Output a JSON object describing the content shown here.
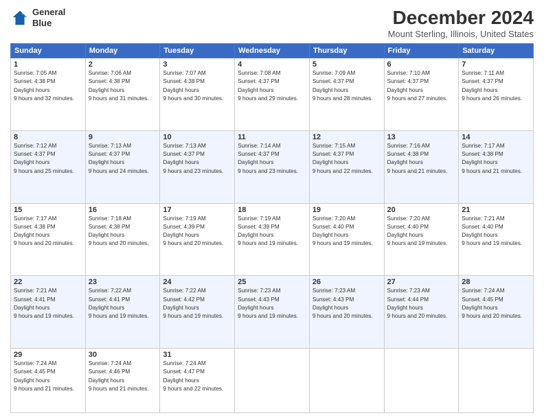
{
  "logo": {
    "line1": "General",
    "line2": "Blue"
  },
  "title": "December 2024",
  "location": "Mount Sterling, Illinois, United States",
  "days_of_week": [
    "Sunday",
    "Monday",
    "Tuesday",
    "Wednesday",
    "Thursday",
    "Friday",
    "Saturday"
  ],
  "weeks": [
    [
      {
        "day": "1",
        "sunrise": "7:05 AM",
        "sunset": "4:38 PM",
        "daylight": "9 hours and 32 minutes."
      },
      {
        "day": "2",
        "sunrise": "7:06 AM",
        "sunset": "4:38 PM",
        "daylight": "9 hours and 31 minutes."
      },
      {
        "day": "3",
        "sunrise": "7:07 AM",
        "sunset": "4:38 PM",
        "daylight": "9 hours and 30 minutes."
      },
      {
        "day": "4",
        "sunrise": "7:08 AM",
        "sunset": "4:37 PM",
        "daylight": "9 hours and 29 minutes."
      },
      {
        "day": "5",
        "sunrise": "7:09 AM",
        "sunset": "4:37 PM",
        "daylight": "9 hours and 28 minutes."
      },
      {
        "day": "6",
        "sunrise": "7:10 AM",
        "sunset": "4:37 PM",
        "daylight": "9 hours and 27 minutes."
      },
      {
        "day": "7",
        "sunrise": "7:11 AM",
        "sunset": "4:37 PM",
        "daylight": "9 hours and 26 minutes."
      }
    ],
    [
      {
        "day": "8",
        "sunrise": "7:12 AM",
        "sunset": "4:37 PM",
        "daylight": "9 hours and 25 minutes."
      },
      {
        "day": "9",
        "sunrise": "7:13 AM",
        "sunset": "4:37 PM",
        "daylight": "9 hours and 24 minutes."
      },
      {
        "day": "10",
        "sunrise": "7:13 AM",
        "sunset": "4:37 PM",
        "daylight": "9 hours and 23 minutes."
      },
      {
        "day": "11",
        "sunrise": "7:14 AM",
        "sunset": "4:37 PM",
        "daylight": "9 hours and 23 minutes."
      },
      {
        "day": "12",
        "sunrise": "7:15 AM",
        "sunset": "4:37 PM",
        "daylight": "9 hours and 22 minutes."
      },
      {
        "day": "13",
        "sunrise": "7:16 AM",
        "sunset": "4:38 PM",
        "daylight": "9 hours and 21 minutes."
      },
      {
        "day": "14",
        "sunrise": "7:17 AM",
        "sunset": "4:38 PM",
        "daylight": "9 hours and 21 minutes."
      }
    ],
    [
      {
        "day": "15",
        "sunrise": "7:17 AM",
        "sunset": "4:38 PM",
        "daylight": "9 hours and 20 minutes."
      },
      {
        "day": "16",
        "sunrise": "7:18 AM",
        "sunset": "4:38 PM",
        "daylight": "9 hours and 20 minutes."
      },
      {
        "day": "17",
        "sunrise": "7:19 AM",
        "sunset": "4:39 PM",
        "daylight": "9 hours and 20 minutes."
      },
      {
        "day": "18",
        "sunrise": "7:19 AM",
        "sunset": "4:39 PM",
        "daylight": "9 hours and 19 minutes."
      },
      {
        "day": "19",
        "sunrise": "7:20 AM",
        "sunset": "4:40 PM",
        "daylight": "9 hours and 19 minutes."
      },
      {
        "day": "20",
        "sunrise": "7:20 AM",
        "sunset": "4:40 PM",
        "daylight": "9 hours and 19 minutes."
      },
      {
        "day": "21",
        "sunrise": "7:21 AM",
        "sunset": "4:40 PM",
        "daylight": "9 hours and 19 minutes."
      }
    ],
    [
      {
        "day": "22",
        "sunrise": "7:21 AM",
        "sunset": "4:41 PM",
        "daylight": "9 hours and 19 minutes."
      },
      {
        "day": "23",
        "sunrise": "7:22 AM",
        "sunset": "4:41 PM",
        "daylight": "9 hours and 19 minutes."
      },
      {
        "day": "24",
        "sunrise": "7:22 AM",
        "sunset": "4:42 PM",
        "daylight": "9 hours and 19 minutes."
      },
      {
        "day": "25",
        "sunrise": "7:23 AM",
        "sunset": "4:43 PM",
        "daylight": "9 hours and 19 minutes."
      },
      {
        "day": "26",
        "sunrise": "7:23 AM",
        "sunset": "4:43 PM",
        "daylight": "9 hours and 20 minutes."
      },
      {
        "day": "27",
        "sunrise": "7:23 AM",
        "sunset": "4:44 PM",
        "daylight": "9 hours and 20 minutes."
      },
      {
        "day": "28",
        "sunrise": "7:24 AM",
        "sunset": "4:45 PM",
        "daylight": "9 hours and 20 minutes."
      }
    ],
    [
      {
        "day": "29",
        "sunrise": "7:24 AM",
        "sunset": "4:45 PM",
        "daylight": "9 hours and 21 minutes."
      },
      {
        "day": "30",
        "sunrise": "7:24 AM",
        "sunset": "4:46 PM",
        "daylight": "9 hours and 21 minutes."
      },
      {
        "day": "31",
        "sunrise": "7:24 AM",
        "sunset": "4:47 PM",
        "daylight": "9 hours and 22 minutes."
      },
      null,
      null,
      null,
      null
    ]
  ]
}
